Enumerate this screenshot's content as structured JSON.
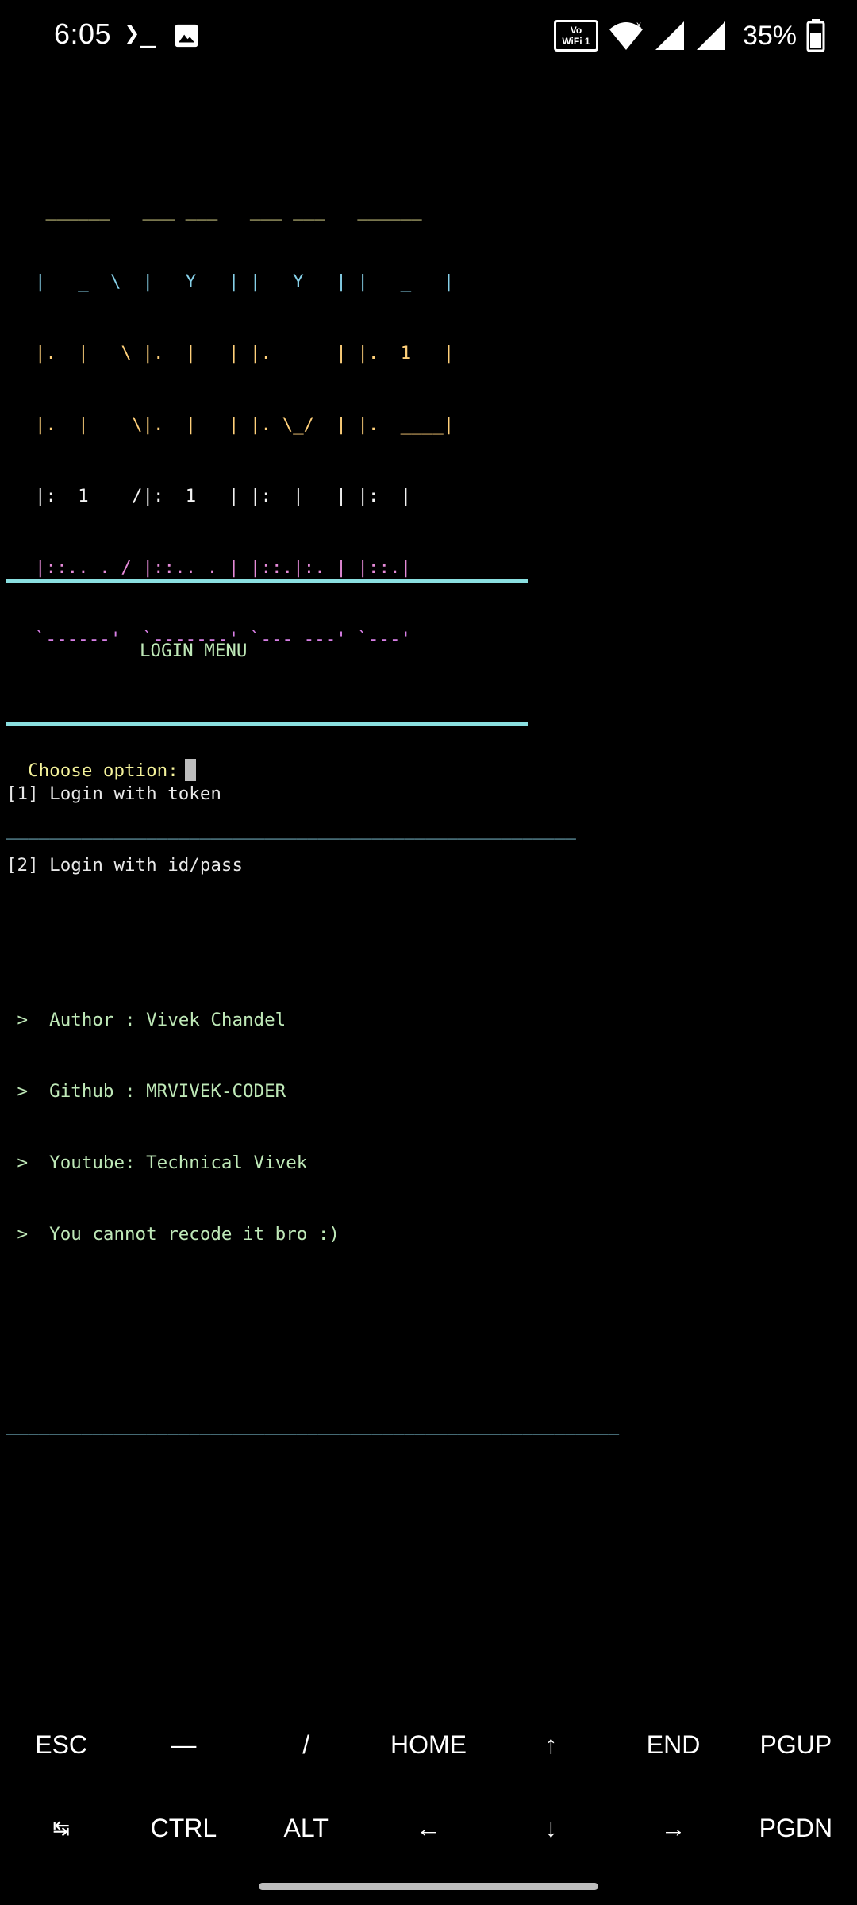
{
  "status_bar": {
    "time": "6:05",
    "terminal_icon": "terminal-icon",
    "gallery_icon": "image-icon",
    "vowifi_label_top": "Vo",
    "vowifi_label_bottom": "WiFi 1",
    "wifi_icon": "wifi-icon",
    "signal_icons": [
      "signal-icon",
      "signal-icon"
    ],
    "battery_percent": "35%",
    "battery_icon": "battery-icon"
  },
  "terminal": {
    "banner_lines": [
      " ______   ___ ___   ___ ___   ______",
      "|   _  \\  |   Y   | |   Y   | |   _   |",
      "|.  |   \\ |.  |   | |.      | |.  1   |",
      "|.  |    \\|.  |   | |. \\_/  | |.  ____|",
      "|:  1    /|:  1   | |:  |   | |:  |",
      "|::.. . / |::.. . | |::.|:. | |::.|",
      "`------'  `-------' `--- ---' `---'"
    ],
    "separator_top": "_____________________________________________________",
    "info_lines": [
      " >  Author : Vivek Chandel",
      " >  Github : MRVIVEK-CODER",
      " >  Youtube: Technical Vivek",
      " >  You cannot recode it bro :)"
    ],
    "separator_bottom": "_________________________________________________________",
    "menu_title": "LOGIN MENU",
    "menu_items": [
      "[1] Login with token",
      "[2] Login with id/pass"
    ],
    "prompt": "Choose option:"
  },
  "extra_keys": {
    "row1": [
      "ESC",
      "—",
      "/",
      "HOME",
      "↑",
      "END",
      "PGUP"
    ],
    "row2": [
      "↹",
      "CTRL",
      "ALT",
      "←",
      "↓",
      "→",
      "PGDN"
    ]
  }
}
